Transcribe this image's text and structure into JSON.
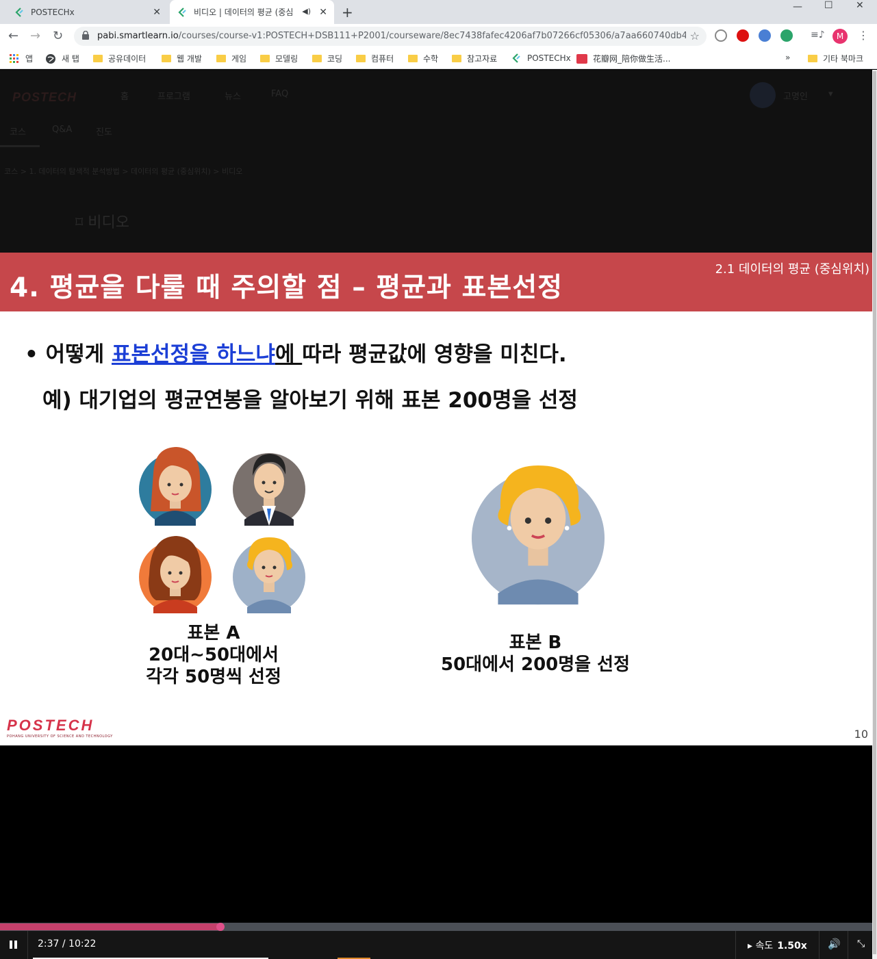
{
  "browser": {
    "tabs": [
      {
        "title": "POSTECHx",
        "close": "✕"
      },
      {
        "title": "비디오 | 데이터의 평균 (중심",
        "close": "✕"
      }
    ],
    "new_tab": "+",
    "window_controls": {
      "minimize": "—",
      "maximize": "☐",
      "close": "✕"
    },
    "nav": {
      "back": "←",
      "forward": "→",
      "reload": "↻"
    },
    "url_host": "pabi.smartlearn.io",
    "url_path": "/courses/course-v1:POSTECH+DSB111+P2001/courseware/8ec7438fafec4206af7b07266cf05306/a7aa660740db4333af...",
    "star": "☆",
    "avatar_letter": "M",
    "menu": "⋮",
    "bookmarks": [
      {
        "label": "앱",
        "icon": "apps-grid-icon"
      },
      {
        "label": "새 탭",
        "icon": "globe-icon"
      },
      {
        "label": "공유데이터",
        "icon": "folder-icon"
      },
      {
        "label": "웹 개발",
        "icon": "folder-icon"
      },
      {
        "label": "게임",
        "icon": "folder-icon"
      },
      {
        "label": "모델링",
        "icon": "folder-icon"
      },
      {
        "label": "코딩",
        "icon": "folder-icon"
      },
      {
        "label": "컴퓨터",
        "icon": "folder-icon"
      },
      {
        "label": "수학",
        "icon": "folder-icon"
      },
      {
        "label": "참고자료",
        "icon": "folder-icon"
      },
      {
        "label": "POSTECHx",
        "icon": "postechx-icon"
      },
      {
        "label": "花瓣网_陪你做生活...",
        "icon": "huaban-icon"
      }
    ],
    "bookmarks_more": "»",
    "other_bookmarks": "기타 북마크"
  },
  "site": {
    "logo": "POSTECH",
    "nav": [
      "홈",
      "프로그램",
      "뉴스",
      "FAQ"
    ],
    "user": "고명인",
    "subnav": [
      "코스",
      "Q&A",
      "진도"
    ],
    "breadcrumb": "코스 > 1. 데이터의 탐색적 분석방법 > 데이터의 평균 (중심위치) > 비디오",
    "unit_title": "비디오"
  },
  "slide": {
    "title": "4. 평균을 다룰 때 주의할 점 – 평균과 표본선정",
    "section": "2.1 데이터의 평균 (중심위치)",
    "bullet": "•",
    "line1_prefix": "어떻게 ",
    "line1_link": "표본선정을 하느냐",
    "line1_link_tail": "에 ",
    "line1_rest": "따라 평균값에 영향을 미친다.",
    "line2": "예) 대기업의 평균연봉을 알아보기 위해 표본 200명을 선정",
    "sample_a": [
      "표본 A",
      "20대~50대에서",
      "각각 50명씩 선정"
    ],
    "sample_b": [
      "표본 B",
      "50대에서 200명을 선정"
    ],
    "logo": "POSTECH",
    "logo_sub": "POHANG UNIVERSITY OF SCIENCE AND TECHNOLOGY",
    "page_number": "10"
  },
  "player": {
    "time": "2:37 / 10:22",
    "progress": 0.253,
    "speed_label": "속도",
    "speed_value": "1.50x",
    "colors": {
      "progress": "#c4406b",
      "header": "#c6474b"
    }
  }
}
